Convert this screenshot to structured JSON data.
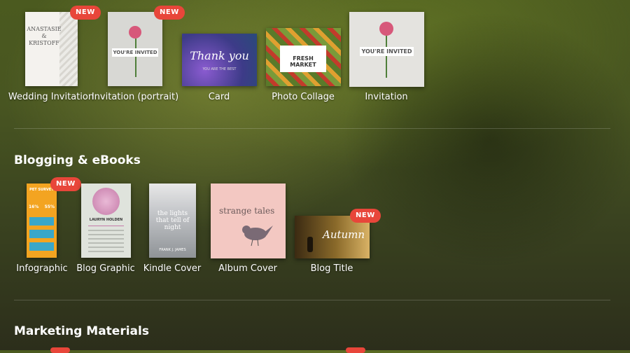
{
  "badge_text": "NEW",
  "row1": {
    "items": [
      {
        "label": "Wedding Invitation",
        "names": [
          "ANASTASIE",
          "&",
          "KRISTOFF"
        ],
        "is_new": true
      },
      {
        "label": "Invitation (portrait)",
        "banner": "YOU'RE INVITED",
        "is_new": true
      },
      {
        "label": "Card",
        "script": "Thank you",
        "sub": "YOU ARE THE BEST"
      },
      {
        "label": "Photo Collage",
        "heading": "FRESH MARKET"
      },
      {
        "label": "Invitation",
        "banner": "YOU'RE INVITED"
      }
    ]
  },
  "sections": [
    {
      "title": "Blogging & eBooks",
      "items": [
        {
          "label": "Infographic",
          "heading": "PET SURVEY",
          "stats": [
            "16%",
            "55%"
          ],
          "is_new": true
        },
        {
          "label": "Blog Graphic",
          "name": "LAURYN HOLDEN"
        },
        {
          "label": "Kindle Cover",
          "title_lines": [
            "the lights",
            "that tell of",
            "night"
          ],
          "author": "FRANK J. JAMES"
        },
        {
          "label": "Album Cover",
          "title": "strange tales"
        },
        {
          "label": "Blog Title",
          "script": "Autumn",
          "is_new": true
        }
      ]
    },
    {
      "title": "Marketing Materials"
    }
  ],
  "colors": {
    "badge": "#e8463a",
    "accent_orange": "#f3a421",
    "album_pink": "#f3c8c2"
  }
}
